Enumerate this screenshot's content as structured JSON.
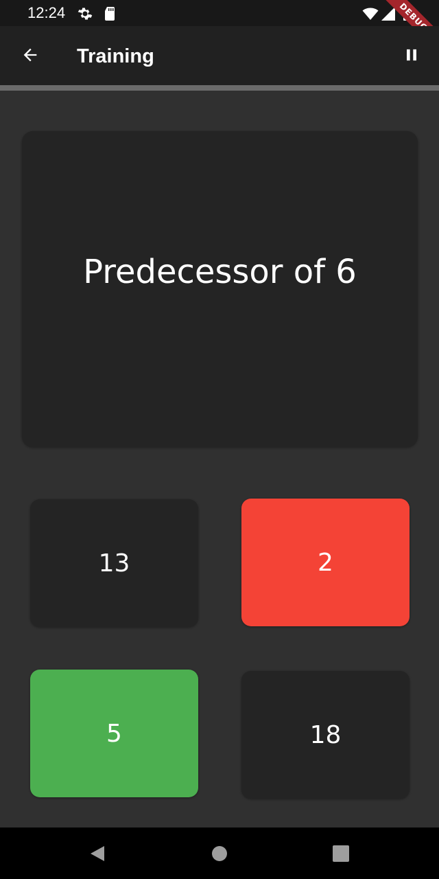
{
  "status_bar": {
    "time": "12:24",
    "debug_label": "DEBUG"
  },
  "app_bar": {
    "title": "Training"
  },
  "progress": {
    "value": 0
  },
  "question": {
    "text": "Predecessor of 6"
  },
  "answers": [
    {
      "label": "13",
      "state": "neutral",
      "color": "#242424"
    },
    {
      "label": "2",
      "state": "wrong",
      "color": "#f44336"
    },
    {
      "label": "5",
      "state": "correct",
      "color": "#4caf50"
    },
    {
      "label": "18",
      "state": "neutral",
      "color": "#242424"
    }
  ],
  "icons": {
    "status_left": [
      "gear-icon",
      "sd-card-icon"
    ],
    "status_right": [
      "wifi-icon",
      "signal-icon",
      "battery-icon"
    ],
    "app_bar_left": "back-arrow-icon",
    "app_bar_right": "pause-icon",
    "nav": [
      "back-triangle-icon",
      "home-circle-icon",
      "recents-square-icon"
    ]
  },
  "colors": {
    "background": "#303030",
    "app_bar": "#212121",
    "card": "#242424",
    "wrong": "#f44336",
    "correct": "#4caf50"
  }
}
